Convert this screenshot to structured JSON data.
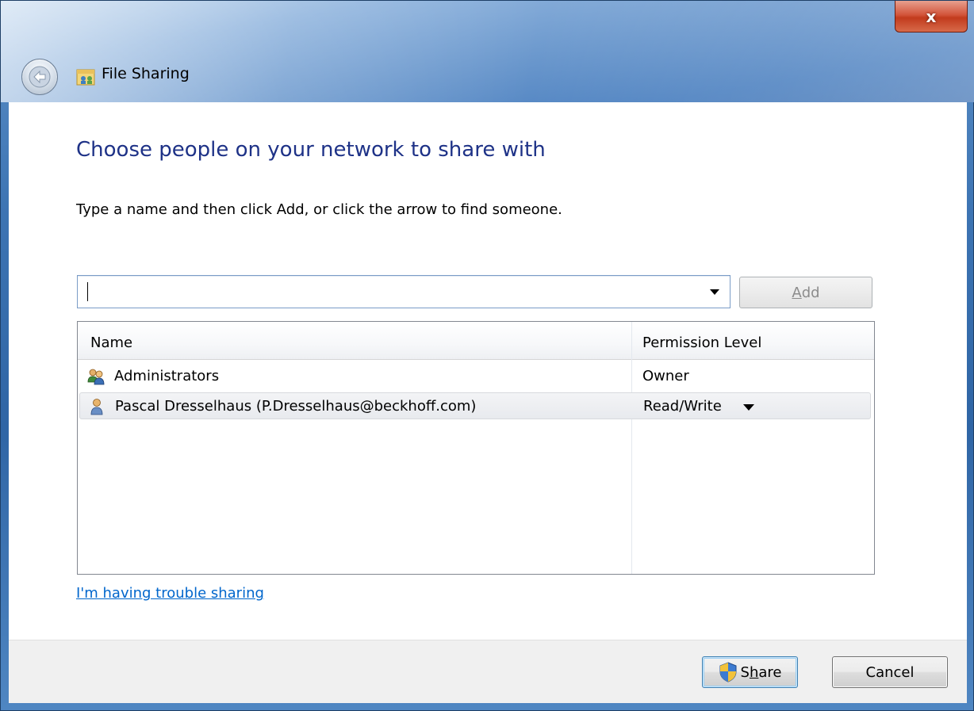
{
  "window": {
    "title": "File Sharing",
    "close_label": "x"
  },
  "main": {
    "heading": "Choose people on your network to share with",
    "instruction": "Type a name and then click Add, or click the arrow to find someone.",
    "name_input": {
      "value": "",
      "placeholder": ""
    },
    "add_button": {
      "label_prefix": "",
      "label_accel": "A",
      "label_rest": "dd",
      "enabled": false
    }
  },
  "list": {
    "columns": {
      "name": "Name",
      "permission": "Permission Level"
    },
    "rows": [
      {
        "name": "Administrators",
        "permission": "Owner",
        "icon": "users-group-icon",
        "selected": false
      },
      {
        "name": "Pascal Dresselhaus (P.Dresselhaus@beckhoff.com)",
        "permission": "Read/Write",
        "icon": "user-icon",
        "selected": true
      }
    ]
  },
  "links": {
    "trouble": "I'm having trouble sharing"
  },
  "footer": {
    "share_prefix": "S",
    "share_accel": "h",
    "share_rest": "are",
    "cancel": "Cancel"
  },
  "colors": {
    "heading": "#1e3287",
    "link": "#0066cc",
    "close_button": "#c23b1d"
  }
}
